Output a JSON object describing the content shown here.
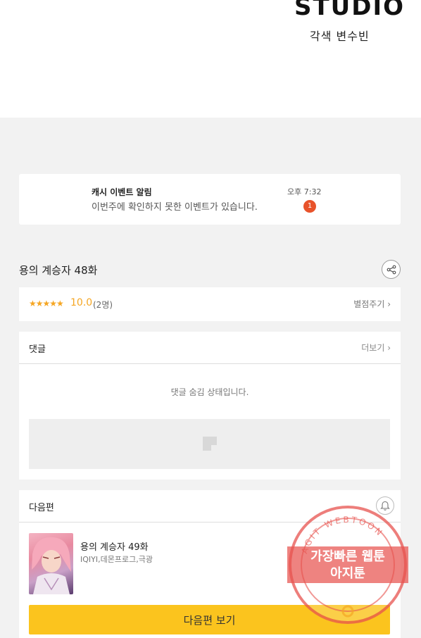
{
  "header": {
    "logo_text": "STUDIO",
    "credit": "각색 변수빈"
  },
  "notice": {
    "title": "캐시 이벤트 알림",
    "message": "이번주에 확인하지 못한 이벤트가 있습니다.",
    "time": "오후 7:32",
    "badge_count": "1"
  },
  "episode": {
    "title": "용의 계승자 48화"
  },
  "rating": {
    "stars": "★★★★★",
    "score": "10.0",
    "count": "(2명)",
    "rate_label": "별점주기 ›"
  },
  "comments": {
    "heading": "댓글",
    "more_label": "더보기 ›",
    "hidden_message": "댓글 숨김 상태입니다."
  },
  "next_episode": {
    "heading": "다음편",
    "title": "용의 계승자 49화",
    "authors": "IQIYI,데몬프로그,극광",
    "button_label": "다음편 보기"
  },
  "watermark": {
    "ring_text": "AGIT WEBTOON",
    "line1": "가장빠른 웹툰",
    "line2": "아지툰"
  },
  "colors": {
    "accent_yellow": "#fbc41e",
    "star_orange": "#f5a623",
    "badge_red": "#e8532b",
    "watermark_red": "#e8534f"
  }
}
